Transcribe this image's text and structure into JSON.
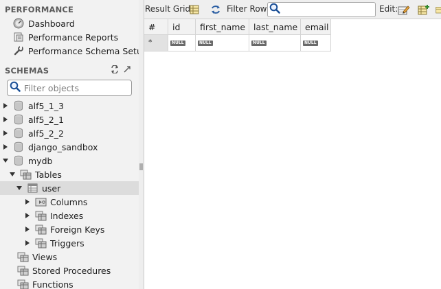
{
  "performance": {
    "heading": "PERFORMANCE",
    "items": [
      {
        "label": "Dashboard"
      },
      {
        "label": "Performance Reports"
      },
      {
        "label": "Performance Schema Setup"
      }
    ]
  },
  "schemas": {
    "heading": "SCHEMAS",
    "filter_placeholder": "Filter objects",
    "tree": [
      {
        "label": "alf5_1_3",
        "expanded": false
      },
      {
        "label": "alf5_2_1",
        "expanded": false
      },
      {
        "label": "alf5_2_2",
        "expanded": false
      },
      {
        "label": "django_sandbox",
        "expanded": false
      },
      {
        "label": "mydb",
        "expanded": true
      },
      {
        "label": "Tables",
        "expanded": true
      },
      {
        "label": "user",
        "expanded": true,
        "selected": true
      },
      {
        "label": "Columns",
        "expanded": false
      },
      {
        "label": "Indexes",
        "expanded": false
      },
      {
        "label": "Foreign Keys",
        "expanded": false
      },
      {
        "label": "Triggers",
        "expanded": false
      },
      {
        "label": "Views"
      },
      {
        "label": "Stored Procedures"
      },
      {
        "label": "Functions"
      }
    ]
  },
  "toolbar": {
    "result_grid_label": "Result Grid",
    "filter_rows_label": "Filter Rows:",
    "filter_rows_value": "",
    "edit_label": "Edit:"
  },
  "grid": {
    "columns": [
      "#",
      "id",
      "first_name",
      "last_name",
      "email"
    ],
    "row_marker": "*",
    "null_text": "NULL"
  }
}
